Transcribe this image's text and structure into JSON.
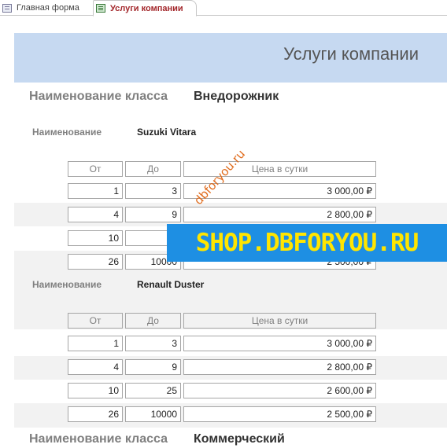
{
  "tabs": [
    {
      "label": "Главная форма",
      "icon": "form-icon"
    },
    {
      "label": "Услуги компании",
      "icon": "report-icon"
    }
  ],
  "report": {
    "title": "Услуги компании",
    "class_caption": "Наименование класса",
    "name_caption": "Наименование",
    "columns": [
      "От",
      "До",
      "Цена в сутки"
    ],
    "groups": [
      {
        "class_value": "Внедорожник",
        "vehicles": [
          {
            "name": "Suzuki Vitara",
            "rows": [
              {
                "from": "1",
                "to": "3",
                "price": "3 000,00 ₽"
              },
              {
                "from": "4",
                "to": "9",
                "price": "2 800,00 ₽"
              },
              {
                "from": "10",
                "to": "",
                "price": ""
              },
              {
                "from": "26",
                "to": "10000",
                "price": "2 500,00 ₽"
              }
            ]
          },
          {
            "name": "Renault Duster",
            "rows": [
              {
                "from": "1",
                "to": "3",
                "price": "3 000,00 ₽"
              },
              {
                "from": "4",
                "to": "9",
                "price": "2 800,00 ₽"
              },
              {
                "from": "10",
                "to": "25",
                "price": "2 600,00 ₽"
              },
              {
                "from": "26",
                "to": "10000",
                "price": "2 500,00 ₽"
              }
            ]
          }
        ]
      },
      {
        "class_value": "Коммерческий",
        "vehicles": []
      }
    ]
  },
  "watermark": {
    "banner": "SHOP.DBFORYOU.RU",
    "diagonal": "dbforyou.ru"
  }
}
